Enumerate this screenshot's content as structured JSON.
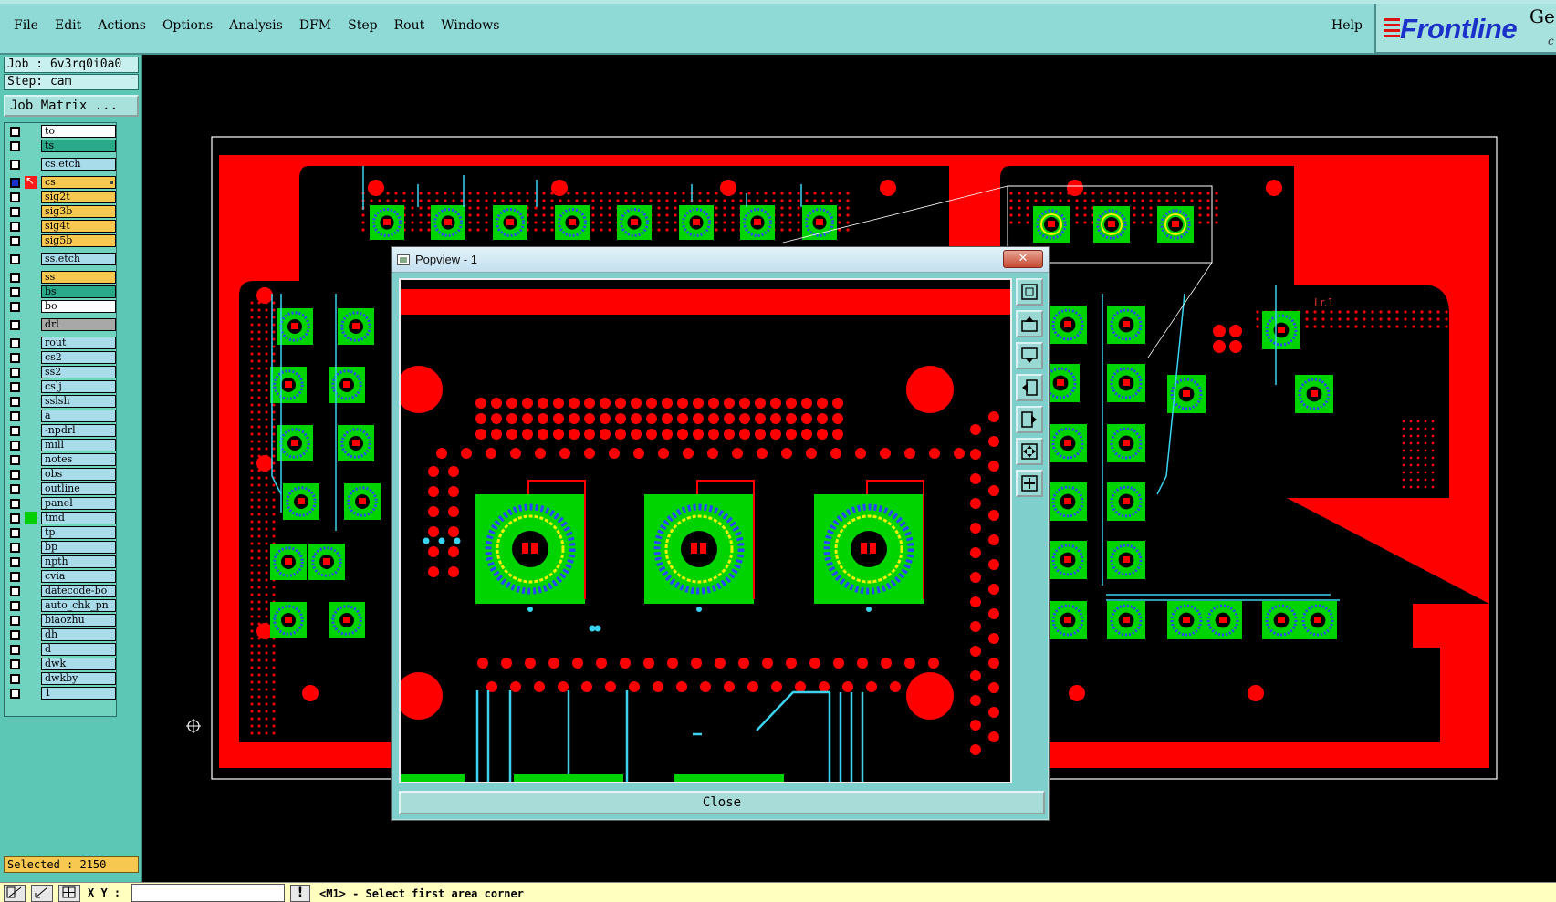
{
  "menu": {
    "items": [
      {
        "label": "File"
      },
      {
        "label": "Edit"
      },
      {
        "label": "Actions"
      },
      {
        "label": "Options"
      },
      {
        "label": "Analysis"
      },
      {
        "label": "DFM"
      },
      {
        "label": "Step"
      },
      {
        "label": "Rout"
      },
      {
        "label": "Windows"
      }
    ],
    "help_label": "Help"
  },
  "logo": {
    "text": "Frontline",
    "partial": "Ge",
    "partial2": "c"
  },
  "job": {
    "label": "Job : 6v3rq0i0a0",
    "step": "Step: cam",
    "matrix_button": "Job Matrix ..."
  },
  "layers": [
    {
      "name": "to",
      "color": "#ffffff",
      "checked": false
    },
    {
      "name": "ts",
      "color": "#2aa88a",
      "checked": false
    },
    {
      "name": "cs.etch",
      "color": "#a8dcea",
      "checked": false
    },
    {
      "name": "cs",
      "color": "#f7c850",
      "checked": true,
      "selected": true
    },
    {
      "name": "sig2t",
      "color": "#f7c850",
      "checked": false
    },
    {
      "name": "sig3b",
      "color": "#f7c850",
      "checked": false
    },
    {
      "name": "sig4t",
      "color": "#f7c850",
      "checked": false
    },
    {
      "name": "sig5b",
      "color": "#f7c850",
      "checked": false
    },
    {
      "name": "ss.etch",
      "color": "#a8dcea",
      "checked": false
    },
    {
      "name": "ss",
      "color": "#f7c850",
      "checked": false
    },
    {
      "name": "bs",
      "color": "#2aa88a",
      "checked": false
    },
    {
      "name": "bo",
      "color": "#ffffff",
      "checked": false
    },
    {
      "name": "drl",
      "color": "#a8a8a8",
      "checked": false
    },
    {
      "name": "rout",
      "color": "#a8dcea",
      "checked": false
    },
    {
      "name": "cs2",
      "color": "#a8dcea",
      "checked": false
    },
    {
      "name": "ss2",
      "color": "#a8dcea",
      "checked": false
    },
    {
      "name": "cslj",
      "color": "#a8dcea",
      "checked": false
    },
    {
      "name": "sslsh",
      "color": "#a8dcea",
      "checked": false
    },
    {
      "name": "a",
      "color": "#a8dcea",
      "checked": false
    },
    {
      "name": "-npdrl",
      "color": "#a8dcea",
      "checked": false
    },
    {
      "name": "mill",
      "color": "#a8dcea",
      "checked": false
    },
    {
      "name": "notes",
      "color": "#a8dcea",
      "checked": false
    },
    {
      "name": "obs",
      "color": "#a8dcea",
      "checked": false
    },
    {
      "name": "outline",
      "color": "#a8dcea",
      "checked": false
    },
    {
      "name": "panel",
      "color": "#a8dcea",
      "checked": false
    },
    {
      "name": "tmd",
      "color": "#a8dcea",
      "checked": false,
      "tmd": true
    },
    {
      "name": "tp",
      "color": "#a8dcea",
      "checked": false
    },
    {
      "name": "bp",
      "color": "#a8dcea",
      "checked": false
    },
    {
      "name": "npth",
      "color": "#a8dcea",
      "checked": false
    },
    {
      "name": "cvia",
      "color": "#a8dcea",
      "checked": false
    },
    {
      "name": "datecode-bo",
      "color": "#a8dcea",
      "checked": false
    },
    {
      "name": "auto_chk_pn",
      "color": "#a8dcea",
      "checked": false
    },
    {
      "name": "biaozhu",
      "color": "#a8dcea",
      "checked": false
    },
    {
      "name": "dh",
      "color": "#a8dcea",
      "checked": false
    },
    {
      "name": "d",
      "color": "#a8dcea",
      "checked": false
    },
    {
      "name": "dwk",
      "color": "#a8dcea",
      "checked": false
    },
    {
      "name": "dwkby",
      "color": "#a8dcea",
      "checked": false
    },
    {
      "name": "1",
      "color": "#a8dcea",
      "checked": false
    }
  ],
  "selected": "Selected : 2150",
  "status": {
    "xy_label": "X Y :",
    "xy_value": "",
    "prompt": "<M1> - Select first area corner"
  },
  "board": {
    "layer_label": "Lr.1"
  },
  "popview": {
    "title": "Popview - 1",
    "close_label": "Close",
    "close_x": "✕"
  },
  "colors": {
    "copper": "#ff0000",
    "pad": "#00d400",
    "trace": "#3ad3f0",
    "ring": "#2848ff",
    "ring_inner": "#f0f000",
    "panel": "#5cc7b4"
  }
}
